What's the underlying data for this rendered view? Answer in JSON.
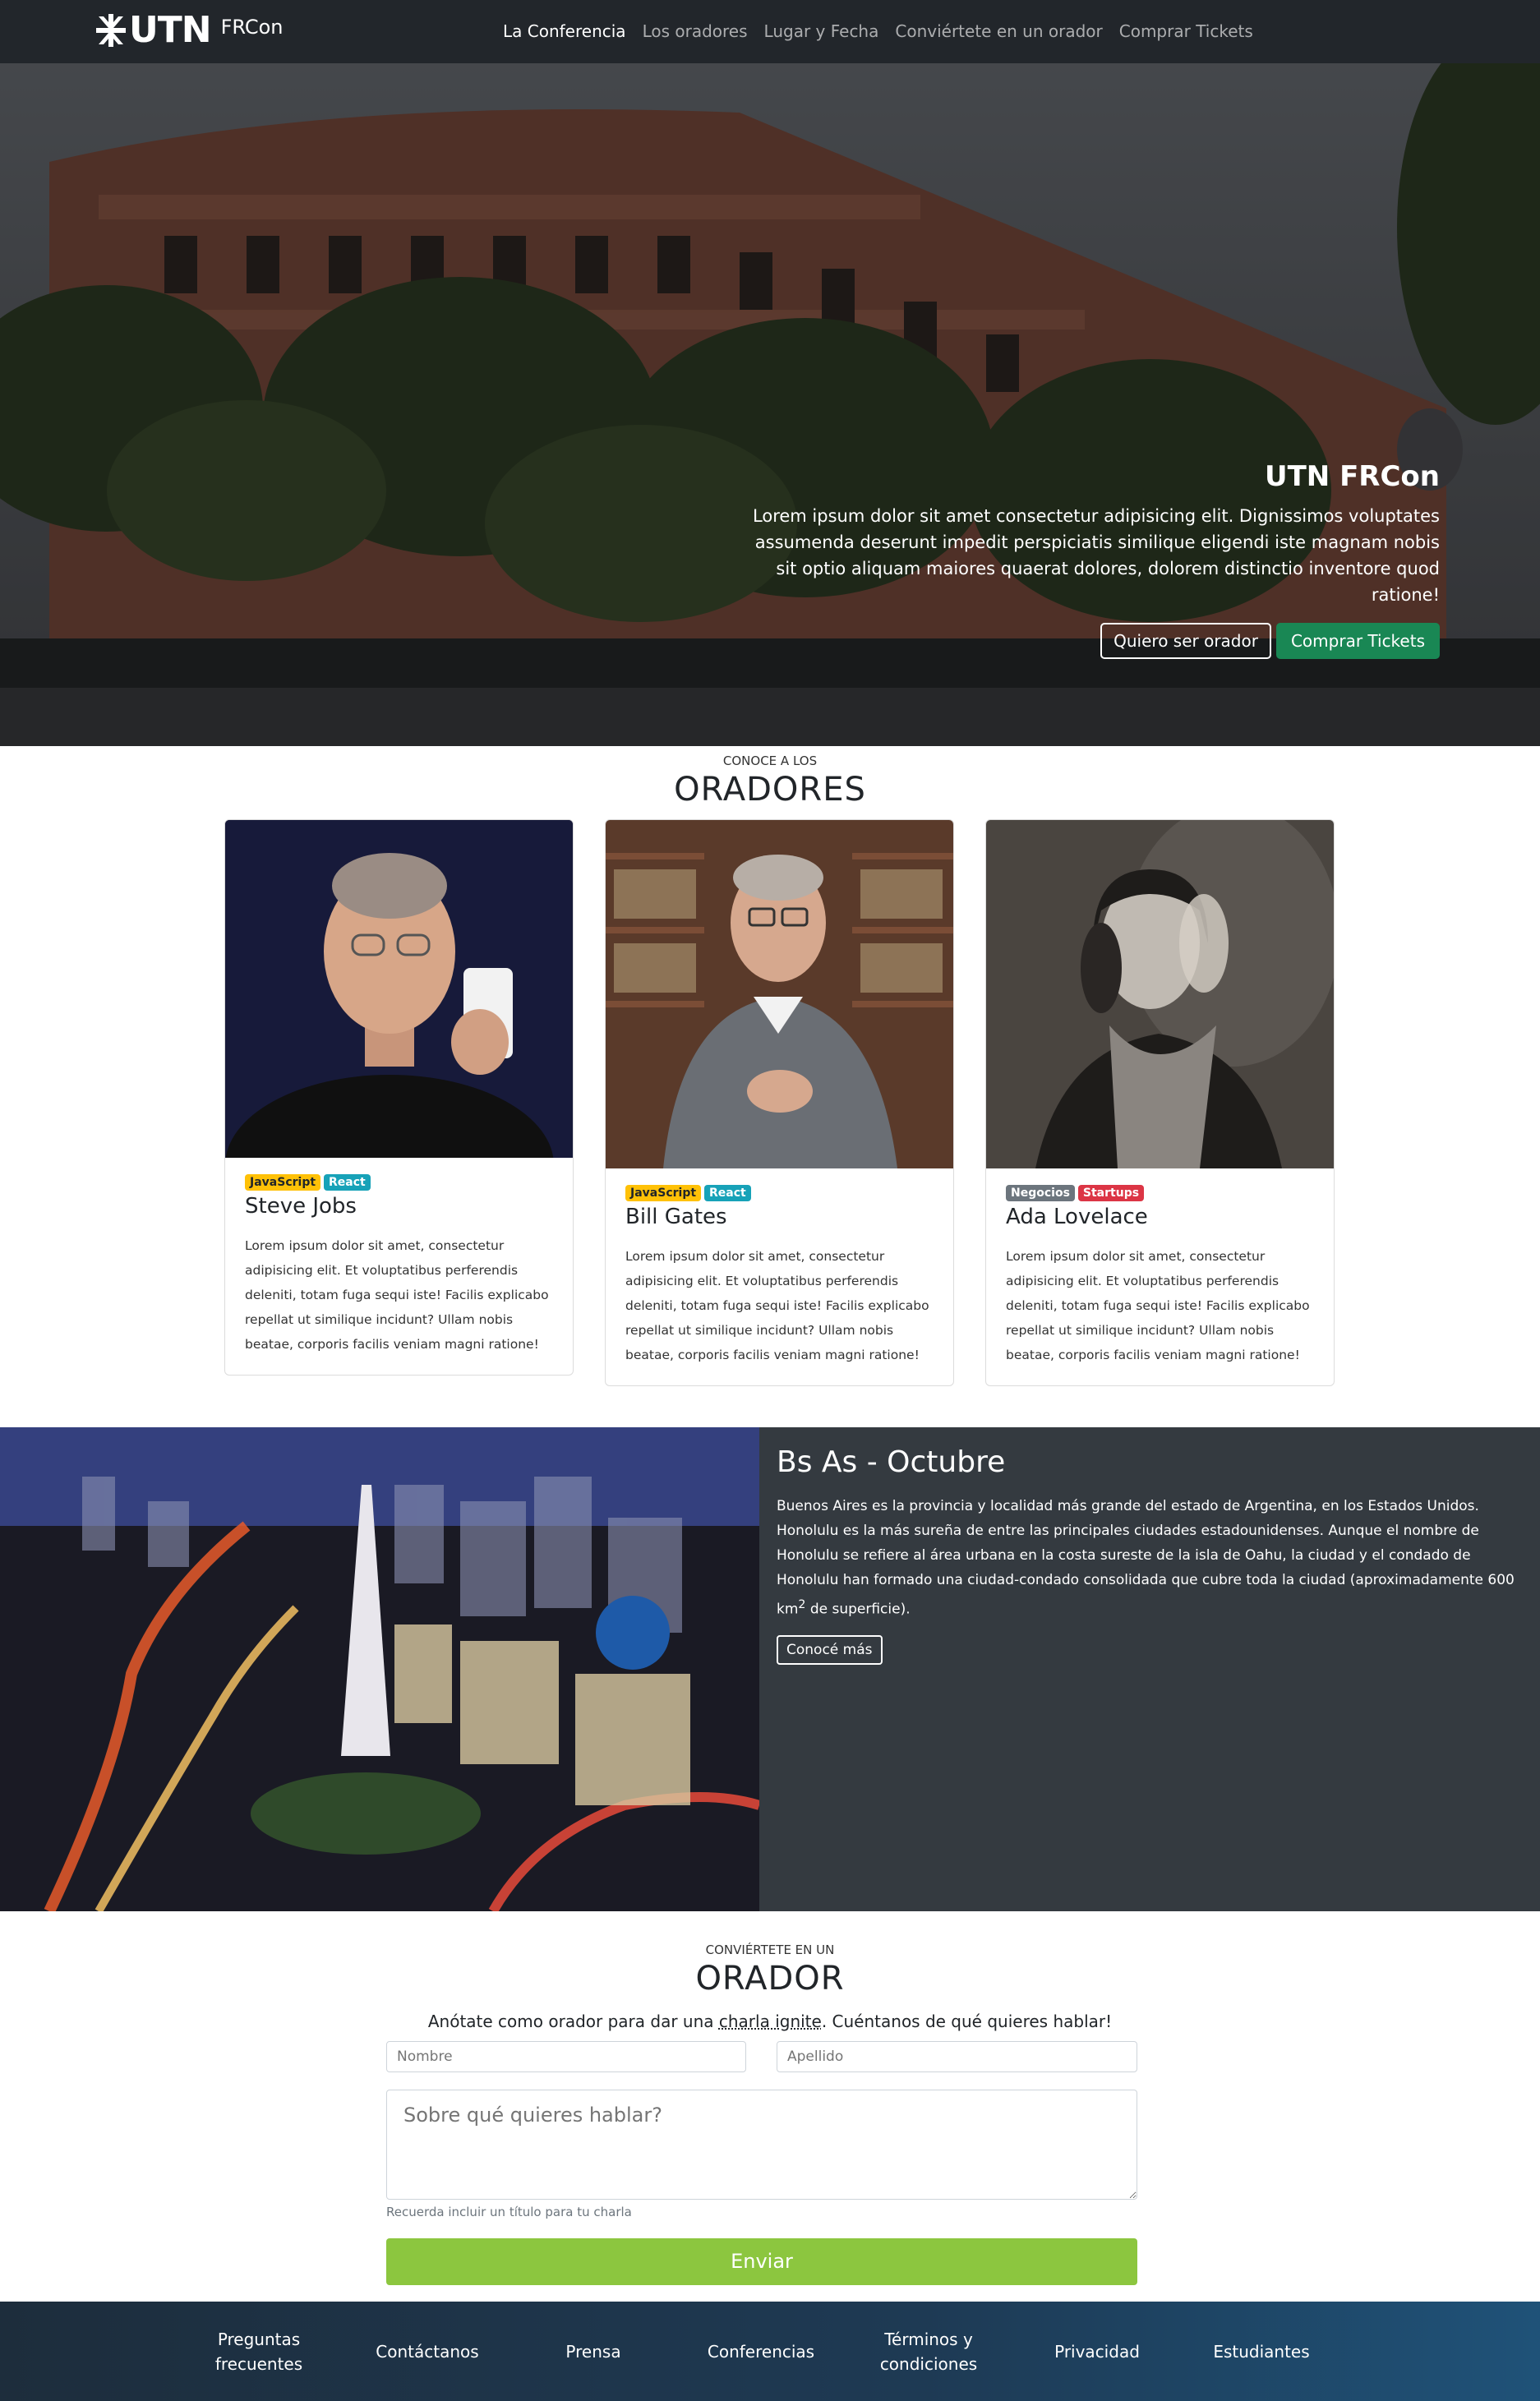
{
  "nav": {
    "brand_utn": "UTN",
    "brand_frcon": "FRCon",
    "links": [
      {
        "label": "La Conferencia",
        "active": true
      },
      {
        "label": "Los oradores",
        "active": false
      },
      {
        "label": "Lugar y Fecha",
        "active": false
      },
      {
        "label": "Conviértete en un orador",
        "active": false
      },
      {
        "label": "Comprar Tickets",
        "active": false
      }
    ]
  },
  "hero": {
    "title": "UTN FRCon",
    "text": "Lorem ipsum dolor sit amet consectetur adipisicing elit. Dignissimos voluptates assumenda deserunt impedit perspiciatis similique eligendi iste magnam nobis sit optio aliquam maiores quaerat dolores, dolorem distinctio inventore quod ratione!",
    "btn_speaker": "Quiero ser orador",
    "btn_tickets": "Comprar Tickets"
  },
  "speakers": {
    "kicker": "CONOCE A LOS",
    "heading": "ORADORES",
    "cards": [
      {
        "name": "Steve Jobs",
        "badges": [
          {
            "label": "JavaScript",
            "type": "warning"
          },
          {
            "label": "React",
            "type": "info"
          }
        ],
        "text": "Lorem ipsum dolor sit amet, consectetur adipisicing elit. Et voluptatibus perferendis deleniti, totam fuga sequi iste! Facilis explicabo repellat ut similique incidunt? Ullam nobis beatae, corporis facilis veniam magni ratione!"
      },
      {
        "name": "Bill Gates",
        "badges": [
          {
            "label": "JavaScript",
            "type": "warning"
          },
          {
            "label": "React",
            "type": "info"
          }
        ],
        "text": "Lorem ipsum dolor sit amet, consectetur adipisicing elit. Et voluptatibus perferendis deleniti, totam fuga sequi iste! Facilis explicabo repellat ut similique incidunt? Ullam nobis beatae, corporis facilis veniam magni ratione!"
      },
      {
        "name": "Ada Lovelace",
        "badges": [
          {
            "label": "Negocios",
            "type": "secondary"
          },
          {
            "label": "Startups",
            "type": "danger"
          }
        ],
        "text": "Lorem ipsum dolor sit amet, consectetur adipisicing elit. Et voluptatibus perferendis deleniti, totam fuga sequi iste! Facilis explicabo repellat ut similique incidunt? Ullam nobis beatae, corporis facilis veniam magni ratione!"
      }
    ]
  },
  "city": {
    "title": "Bs As - Octubre",
    "desc_before_sup": "Buenos Aires es la provincia y localidad más grande del estado de Argentina, en los Estados Unidos. Honolulu es la más sureña de entre las principales ciudades estadounidenses. Aunque el nombre de Honolulu se refiere al área urbana en la costa sureste de la isla de Oahu, la ciudad y el condado de Honolulu han formado una ciudad-condado consolidada que cubre toda la ciudad (aproximadamente 600 km",
    "desc_sup": "2",
    "desc_after_sup": " de superficie).",
    "button": "Conocé más"
  },
  "form": {
    "kicker": "CONVIÉRTETE EN UN",
    "heading": "ORADOR",
    "intro_before": "Anótate como orador para dar una ",
    "intro_abbr": "charla ignite",
    "intro_after": ". Cuéntanos de qué quieres hablar!",
    "first_name_placeholder": "Nombre",
    "last_name_placeholder": "Apellido",
    "topic_placeholder": "Sobre qué quieres hablar?",
    "help": "Recuerda incluir un título para tu charla",
    "submit": "Enviar"
  },
  "footer": {
    "links": [
      "Preguntas frecuentes",
      "Contáctanos",
      "Prensa",
      "Conferencias",
      "Términos y condiciones",
      "Privacidad",
      "Estudiantes"
    ]
  },
  "colors": {
    "navbar": "#22262b",
    "success": "#198754",
    "submit": "#8cc63f",
    "city_bg": "#343a40"
  }
}
